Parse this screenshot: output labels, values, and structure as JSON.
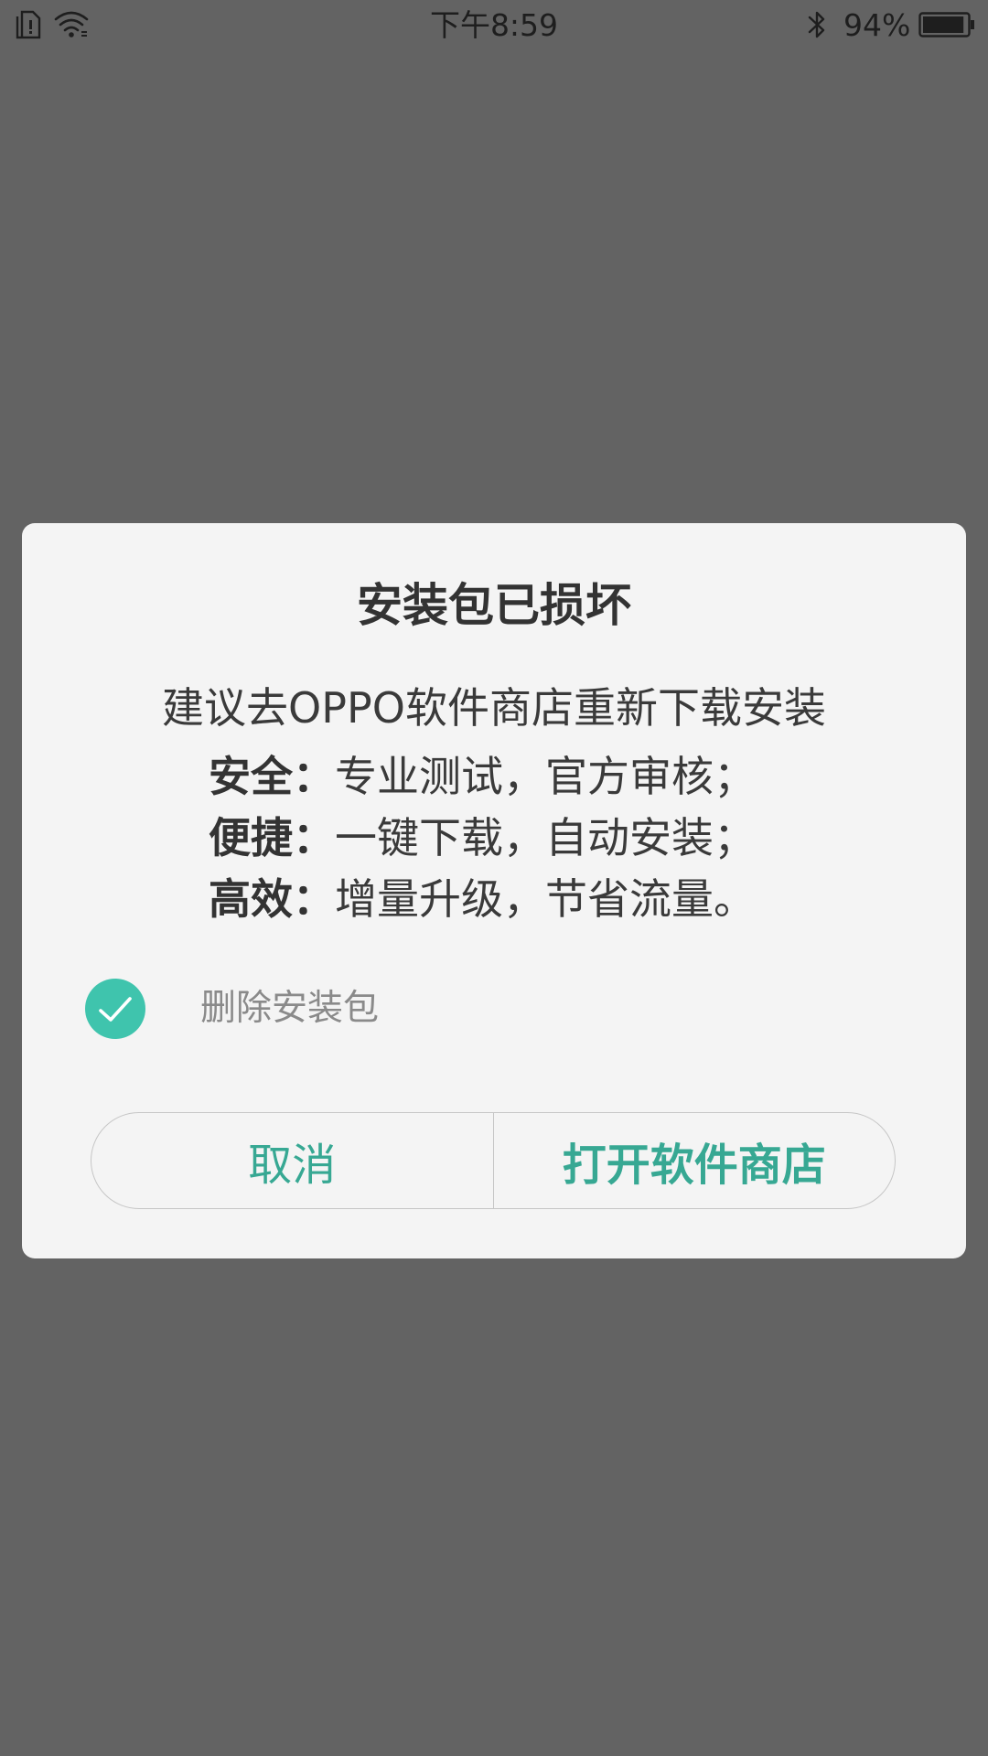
{
  "status_bar": {
    "time": "下午8:59",
    "battery_percent_text": "94%",
    "battery_level": 0.94,
    "icons": [
      "sim-card-icon",
      "wifi-icon",
      "bluetooth-icon",
      "battery-icon"
    ]
  },
  "dialog": {
    "title": "安装包已损坏",
    "message": "建议去OPPO软件商店重新下载安装",
    "features": [
      {
        "key": "安全：",
        "value": "专业测试，官方审核；"
      },
      {
        "key": "便捷：",
        "value": "一键下载，自动安装；"
      },
      {
        "key": "高效：",
        "value": "增量升级，节省流量。"
      }
    ],
    "checkbox": {
      "label": "删除安装包",
      "checked": true
    },
    "buttons": {
      "cancel": "取消",
      "confirm": "打开软件商店"
    }
  },
  "colors": {
    "overlay": "#636363",
    "dialog_bg": "#f4f4f4",
    "accent": "#37a893",
    "check_fill": "#3fc4ad"
  }
}
